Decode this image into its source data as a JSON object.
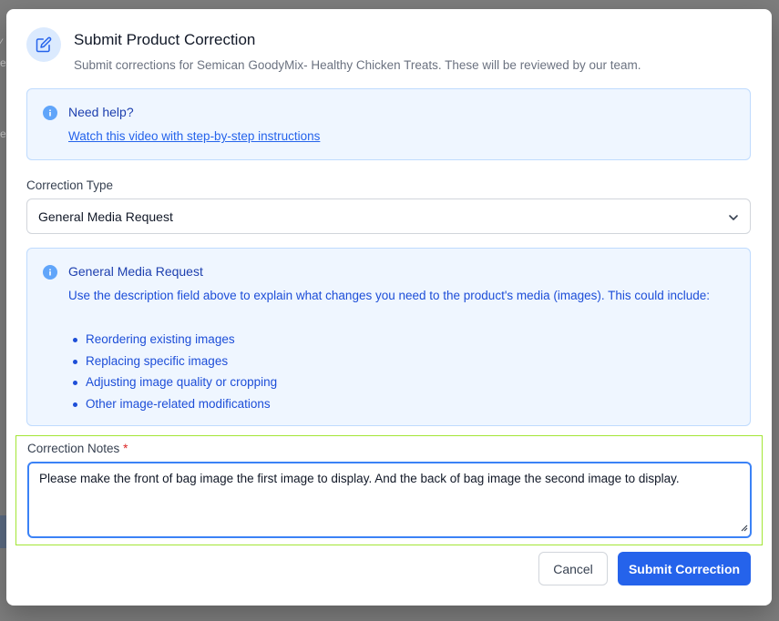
{
  "dialog": {
    "title": "Submit Product Correction",
    "subtitle": "Submit corrections for Semican GoodyMix- Healthy Chicken Treats. These will be reviewed by our team."
  },
  "help": {
    "title": "Need help?",
    "link_text": "Watch this video with step-by-step instructions"
  },
  "correction_type": {
    "label": "Correction Type",
    "selected": "General Media Request"
  },
  "info": {
    "title": "General Media Request",
    "description": "Use the description field above to explain what changes you need to the product's media (images). This could include:",
    "items": [
      "Reordering existing images",
      "Replacing specific images",
      "Adjusting image quality or cropping",
      "Other image-related modifications"
    ]
  },
  "notes": {
    "label": "Correction Notes",
    "required_mark": "*",
    "value": "Please make the front of bag image the first image to display. And the back of bag image the second image to display."
  },
  "buttons": {
    "cancel": "Cancel",
    "submit": "Submit Correction"
  },
  "colors": {
    "primary": "#2563eb",
    "info_bg": "#eff6ff",
    "info_text": "#1d4ed8",
    "focus_outline": "#a3e635"
  },
  "icons": {
    "header": "edit-icon",
    "info": "info-icon",
    "select": "chevron-down-icon"
  }
}
